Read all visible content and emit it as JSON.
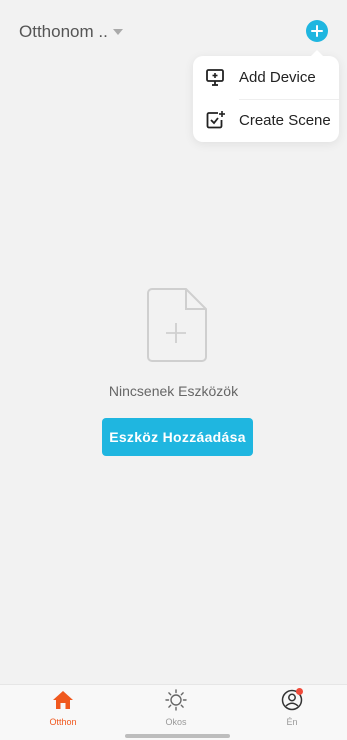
{
  "header": {
    "home_name": "Otthonom ..",
    "add_icon": "plus-circle-icon"
  },
  "popup_menu": {
    "items": [
      {
        "label": "Add Device",
        "icon": "add-device-icon"
      },
      {
        "label": "Create Scene",
        "icon": "create-scene-icon"
      }
    ]
  },
  "empty_state": {
    "icon": "empty-document-plus-icon",
    "message": "Nincsenek Eszközök",
    "button_label": "Eszköz Hozzáadása"
  },
  "tabbar": {
    "tabs": [
      {
        "label": "Otthon",
        "icon": "home-icon",
        "active": true
      },
      {
        "label": "Okos",
        "icon": "sun-icon",
        "active": false
      },
      {
        "label": "Én",
        "icon": "user-icon",
        "active": false,
        "badge": true
      }
    ]
  },
  "colors": {
    "accent": "#1fb6e0",
    "active_tab": "#f0581e",
    "badge": "#f04a3a",
    "background": "#f2f2f2"
  }
}
